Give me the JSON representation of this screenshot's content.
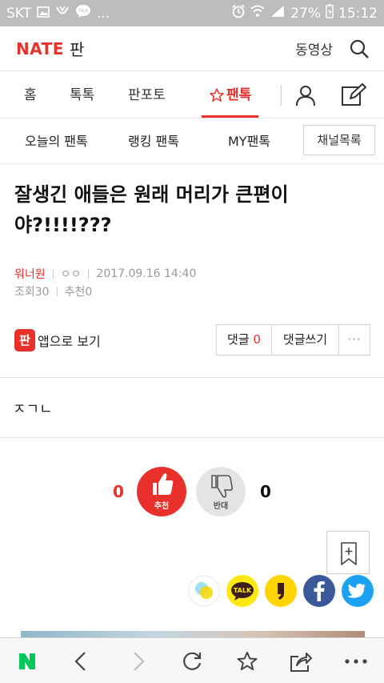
{
  "status_bar": {
    "carrier": "SKT",
    "talk_badge": "TALK",
    "ellipsis": "...",
    "battery": "27%",
    "time": "15:12"
  },
  "header": {
    "logo": "NATE",
    "logo_sub": "판",
    "video_label": "동영상"
  },
  "main_nav": {
    "tabs": [
      "홈",
      "톡톡",
      "판포토",
      "팬톡"
    ],
    "active": "팬톡"
  },
  "sub_nav": {
    "items": [
      "오늘의 팬톡",
      "랭킹 팬톡",
      "MY팬톡"
    ],
    "channel_button": "채널목록"
  },
  "article": {
    "title": "잘생긴 애들은 원래 머리가 큰편이 야?!!!!???",
    "author": "워너원",
    "nickname": "ㅇㅇ",
    "date": "2017.09.16 14:40",
    "views": "조회30",
    "recommends": "추천0",
    "body": "ㅈㄱㄴ"
  },
  "app_view": {
    "icon_text": "판",
    "label": "앱으로 보기"
  },
  "comments": {
    "label": "댓글",
    "count": "0",
    "write_label": "댓글쓰기",
    "more": "···"
  },
  "vote": {
    "up_count": "0",
    "up_label": "추천",
    "down_label": "반대",
    "down_count": "0"
  },
  "share": {
    "kakaotalk_label": "TALK"
  },
  "colors": {
    "accent": "#e8312b",
    "facebook": "#3b5998",
    "twitter": "#1da1f2",
    "kakao": "#ffe812"
  },
  "bottom_bar": {
    "icons": [
      "naver-home-icon",
      "back-icon",
      "forward-icon",
      "refresh-icon",
      "bookmark-star-icon",
      "share-icon",
      "more-icon"
    ]
  }
}
